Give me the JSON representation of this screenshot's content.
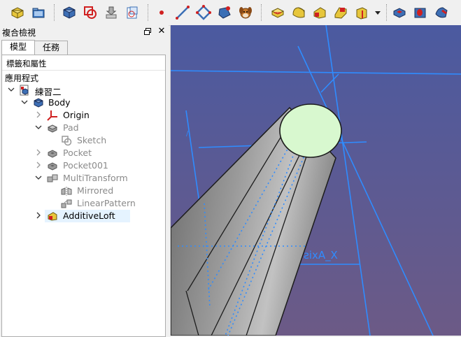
{
  "toolbar": {
    "buttons": [
      "part-icon",
      "open-icon",
      "body-icon",
      "sketch-icon",
      "shape-binder-icon",
      "clone-icon",
      "point-icon",
      "line-icon",
      "plane-icon",
      "lcs-icon",
      "mascot-icon",
      "pad-icon",
      "revolution-icon",
      "additive-loft-icon",
      "additive-pipe-icon",
      "additive-helix-icon",
      "dropdown-arrow-icon",
      "pocket-icon",
      "hole-icon",
      "groove-icon"
    ]
  },
  "panel": {
    "title": "複合檢視",
    "tabs": [
      "模型",
      "任務"
    ],
    "tree_header": "標籤和屬性",
    "application_label": "應用程式",
    "items": [
      {
        "label": "練習二",
        "icon": "document-icon",
        "state": "expanded",
        "style": "normal"
      },
      {
        "label": "Body",
        "icon": "body-icon",
        "state": "expanded",
        "style": "normal"
      },
      {
        "label": "Origin",
        "icon": "origin-icon",
        "state": "collapsed",
        "style": "normal"
      },
      {
        "label": "Pad",
        "icon": "pad-icon",
        "state": "expanded",
        "style": "grey"
      },
      {
        "label": "Sketch",
        "icon": "sketch-icon",
        "state": "none",
        "style": "grey"
      },
      {
        "label": "Pocket",
        "icon": "pocket-icon",
        "state": "collapsed",
        "style": "grey"
      },
      {
        "label": "Pocket001",
        "icon": "pocket-icon",
        "state": "collapsed",
        "style": "grey"
      },
      {
        "label": "MultiTransform",
        "icon": "multitransform-icon",
        "state": "expanded",
        "style": "grey"
      },
      {
        "label": "Mirrored",
        "icon": "mirrored-icon",
        "state": "none",
        "style": "grey"
      },
      {
        "label": "LinearPattern",
        "icon": "linear-pattern-icon",
        "state": "none",
        "style": "grey"
      },
      {
        "label": "AdditiveLoft",
        "icon": "additive-loft-icon",
        "state": "collapsed",
        "style": "selected"
      }
    ]
  },
  "viewport": {
    "axis_label": "X_Axis",
    "background_top": "#4b5aa0",
    "background_bottom": "#6c5a86",
    "datum_color": "#2f8cff",
    "face_color": "#d8f8cf"
  }
}
